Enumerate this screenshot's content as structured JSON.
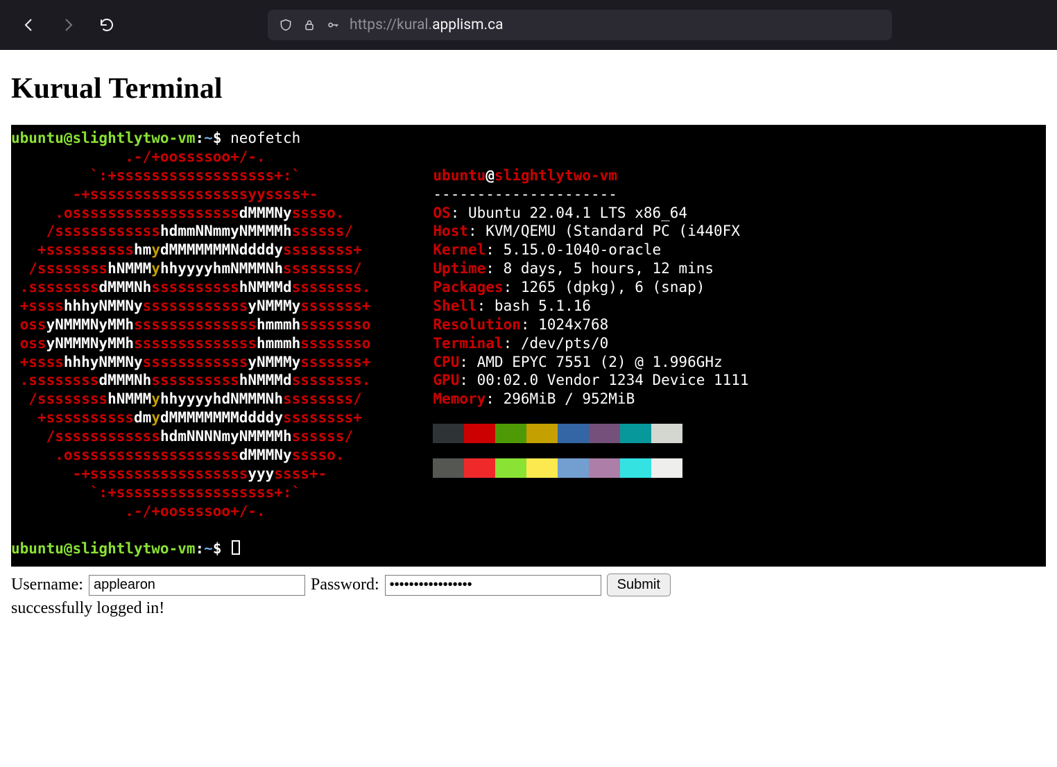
{
  "browser": {
    "url_prefix": "https://kural.",
    "url_domain": "applism.ca"
  },
  "page_title": "Kurual Terminal",
  "prompt": {
    "user_host": "ubuntu@slightlytwo-vm",
    "path": "~",
    "command": "neofetch"
  },
  "neofetch": {
    "title_user": "ubuntu",
    "title_host": "slightlytwo-vm",
    "separator": "---------------------",
    "info": [
      {
        "k": "OS",
        "v": "Ubuntu 22.04.1 LTS x86_64"
      },
      {
        "k": "Host",
        "v": "KVM/QEMU (Standard PC (i440FX"
      },
      {
        "k": "Kernel",
        "v": "5.15.0-1040-oracle"
      },
      {
        "k": "Uptime",
        "v": "8 days, 5 hours, 12 mins"
      },
      {
        "k": "Packages",
        "v": "1265 (dpkg), 6 (snap)"
      },
      {
        "k": "Shell",
        "v": "bash 5.1.16"
      },
      {
        "k": "Resolution",
        "v": "1024x768"
      },
      {
        "k": "Terminal",
        "v": "/dev/pts/0"
      },
      {
        "k": "CPU",
        "v": "AMD EPYC 7551 (2) @ 1.996GHz"
      },
      {
        "k": "GPU",
        "v": "00:02.0 Vendor 1234 Device 1111"
      },
      {
        "k": "Memory",
        "v": "296MiB / 952MiB"
      }
    ],
    "swatches_row1": [
      "#2e3436",
      "#cc0000",
      "#4e9a06",
      "#c4a000",
      "#3465a4",
      "#75507b",
      "#06989a",
      "#d3d7cf"
    ],
    "swatches_row2": [
      "#555753",
      "#ef2929",
      "#8ae234",
      "#fce94f",
      "#729fcf",
      "#ad7fa8",
      "#34e2e2",
      "#eeeeec"
    ]
  },
  "login": {
    "username_label": "Username:",
    "password_label": "Password:",
    "username_value": "applearon",
    "password_value": "•••••••••••••••••",
    "submit_label": "Submit",
    "status": "successfully logged in!"
  }
}
